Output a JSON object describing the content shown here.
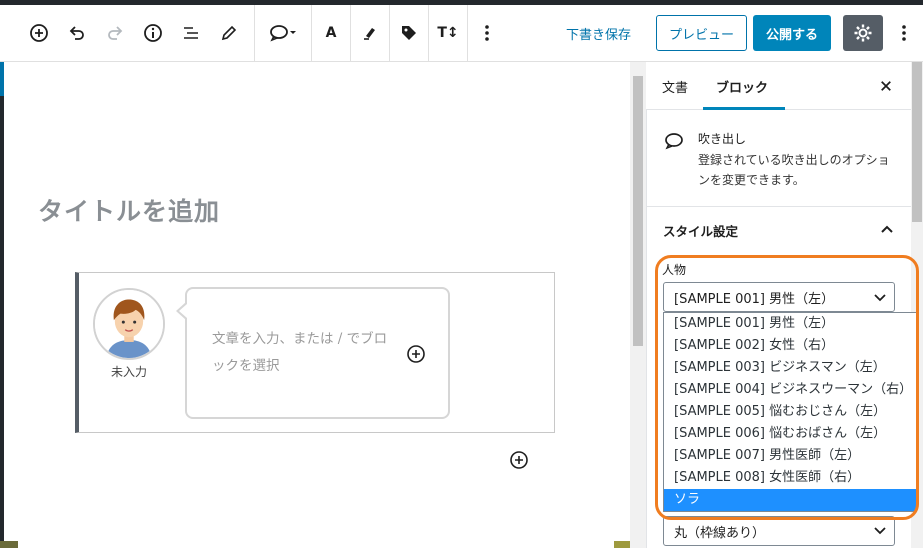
{
  "toolbar": {
    "save_draft": "下書き保存",
    "preview": "プレビュー",
    "publish": "公開する",
    "font_a": "A",
    "font_size": "T↕"
  },
  "editor": {
    "title_placeholder": "タイトルを追加",
    "avatar_name": "未入力",
    "bubble_placeholder": "文章を入力、または / でブロックを選択"
  },
  "sidebar": {
    "tab_document": "文書",
    "tab_block": "ブロック",
    "block_title": "吹き出し",
    "block_description": "登録されている吹き出しのオプションを変更できます。",
    "panel_title": "スタイル設定",
    "person_label": "人物",
    "person_selected": "[SAMPLE 001] 男性（左）",
    "person_options": [
      "[SAMPLE 001] 男性（左）",
      "[SAMPLE 002] 女性（右）",
      "[SAMPLE 003] ビジネスマン（左）",
      "[SAMPLE 004] ビジネスウーマン（右）",
      "[SAMPLE 005] 悩むおじさん（左）",
      "[SAMPLE 006] 悩むおばさん（左）",
      "[SAMPLE 007] 男性医師（左）",
      "[SAMPLE 008] 女性医師（右）",
      "ソラ"
    ],
    "highlighted_option": "ソラ",
    "shape_selected": "丸（枠線あり）"
  },
  "colors": {
    "accent": "#0085ba",
    "highlight_ring": "#f07d20",
    "option_highlight": "#1e90ff"
  }
}
